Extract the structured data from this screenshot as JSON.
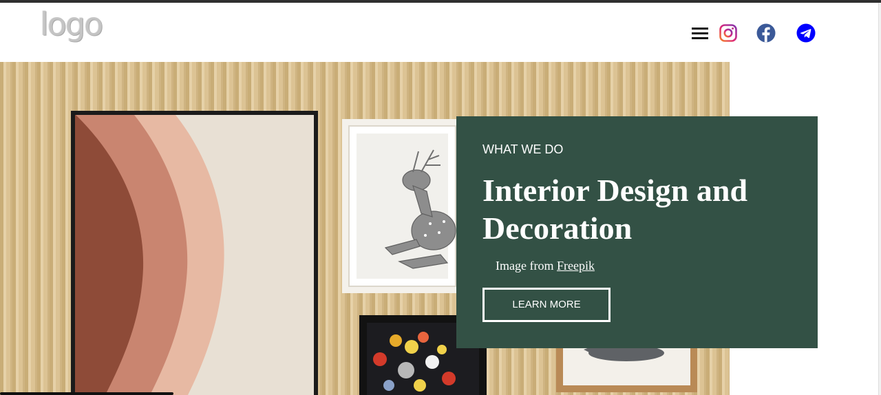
{
  "header": {
    "logo_text": "logo",
    "menu_icon": "hamburger-menu-icon",
    "social": [
      {
        "name": "instagram",
        "icon": "instagram-icon",
        "color": "#d6249f"
      },
      {
        "name": "facebook",
        "icon": "facebook-icon",
        "color": "#3b5998"
      },
      {
        "name": "telegram",
        "icon": "telegram-icon",
        "color": "#0000ff"
      }
    ]
  },
  "hero": {
    "image": "interior-gallery-wall-image",
    "card": {
      "eyebrow": "WHAT WE DO",
      "title": "Interior Design and Decoration",
      "credit_prefix": "Image from ",
      "credit_link": "Freepik",
      "button_label": "LEARN MORE",
      "background": "#335145"
    }
  },
  "colors": {
    "topbar": "#2f2f2f",
    "card": "#335145",
    "wall": "#d8bf8e"
  }
}
